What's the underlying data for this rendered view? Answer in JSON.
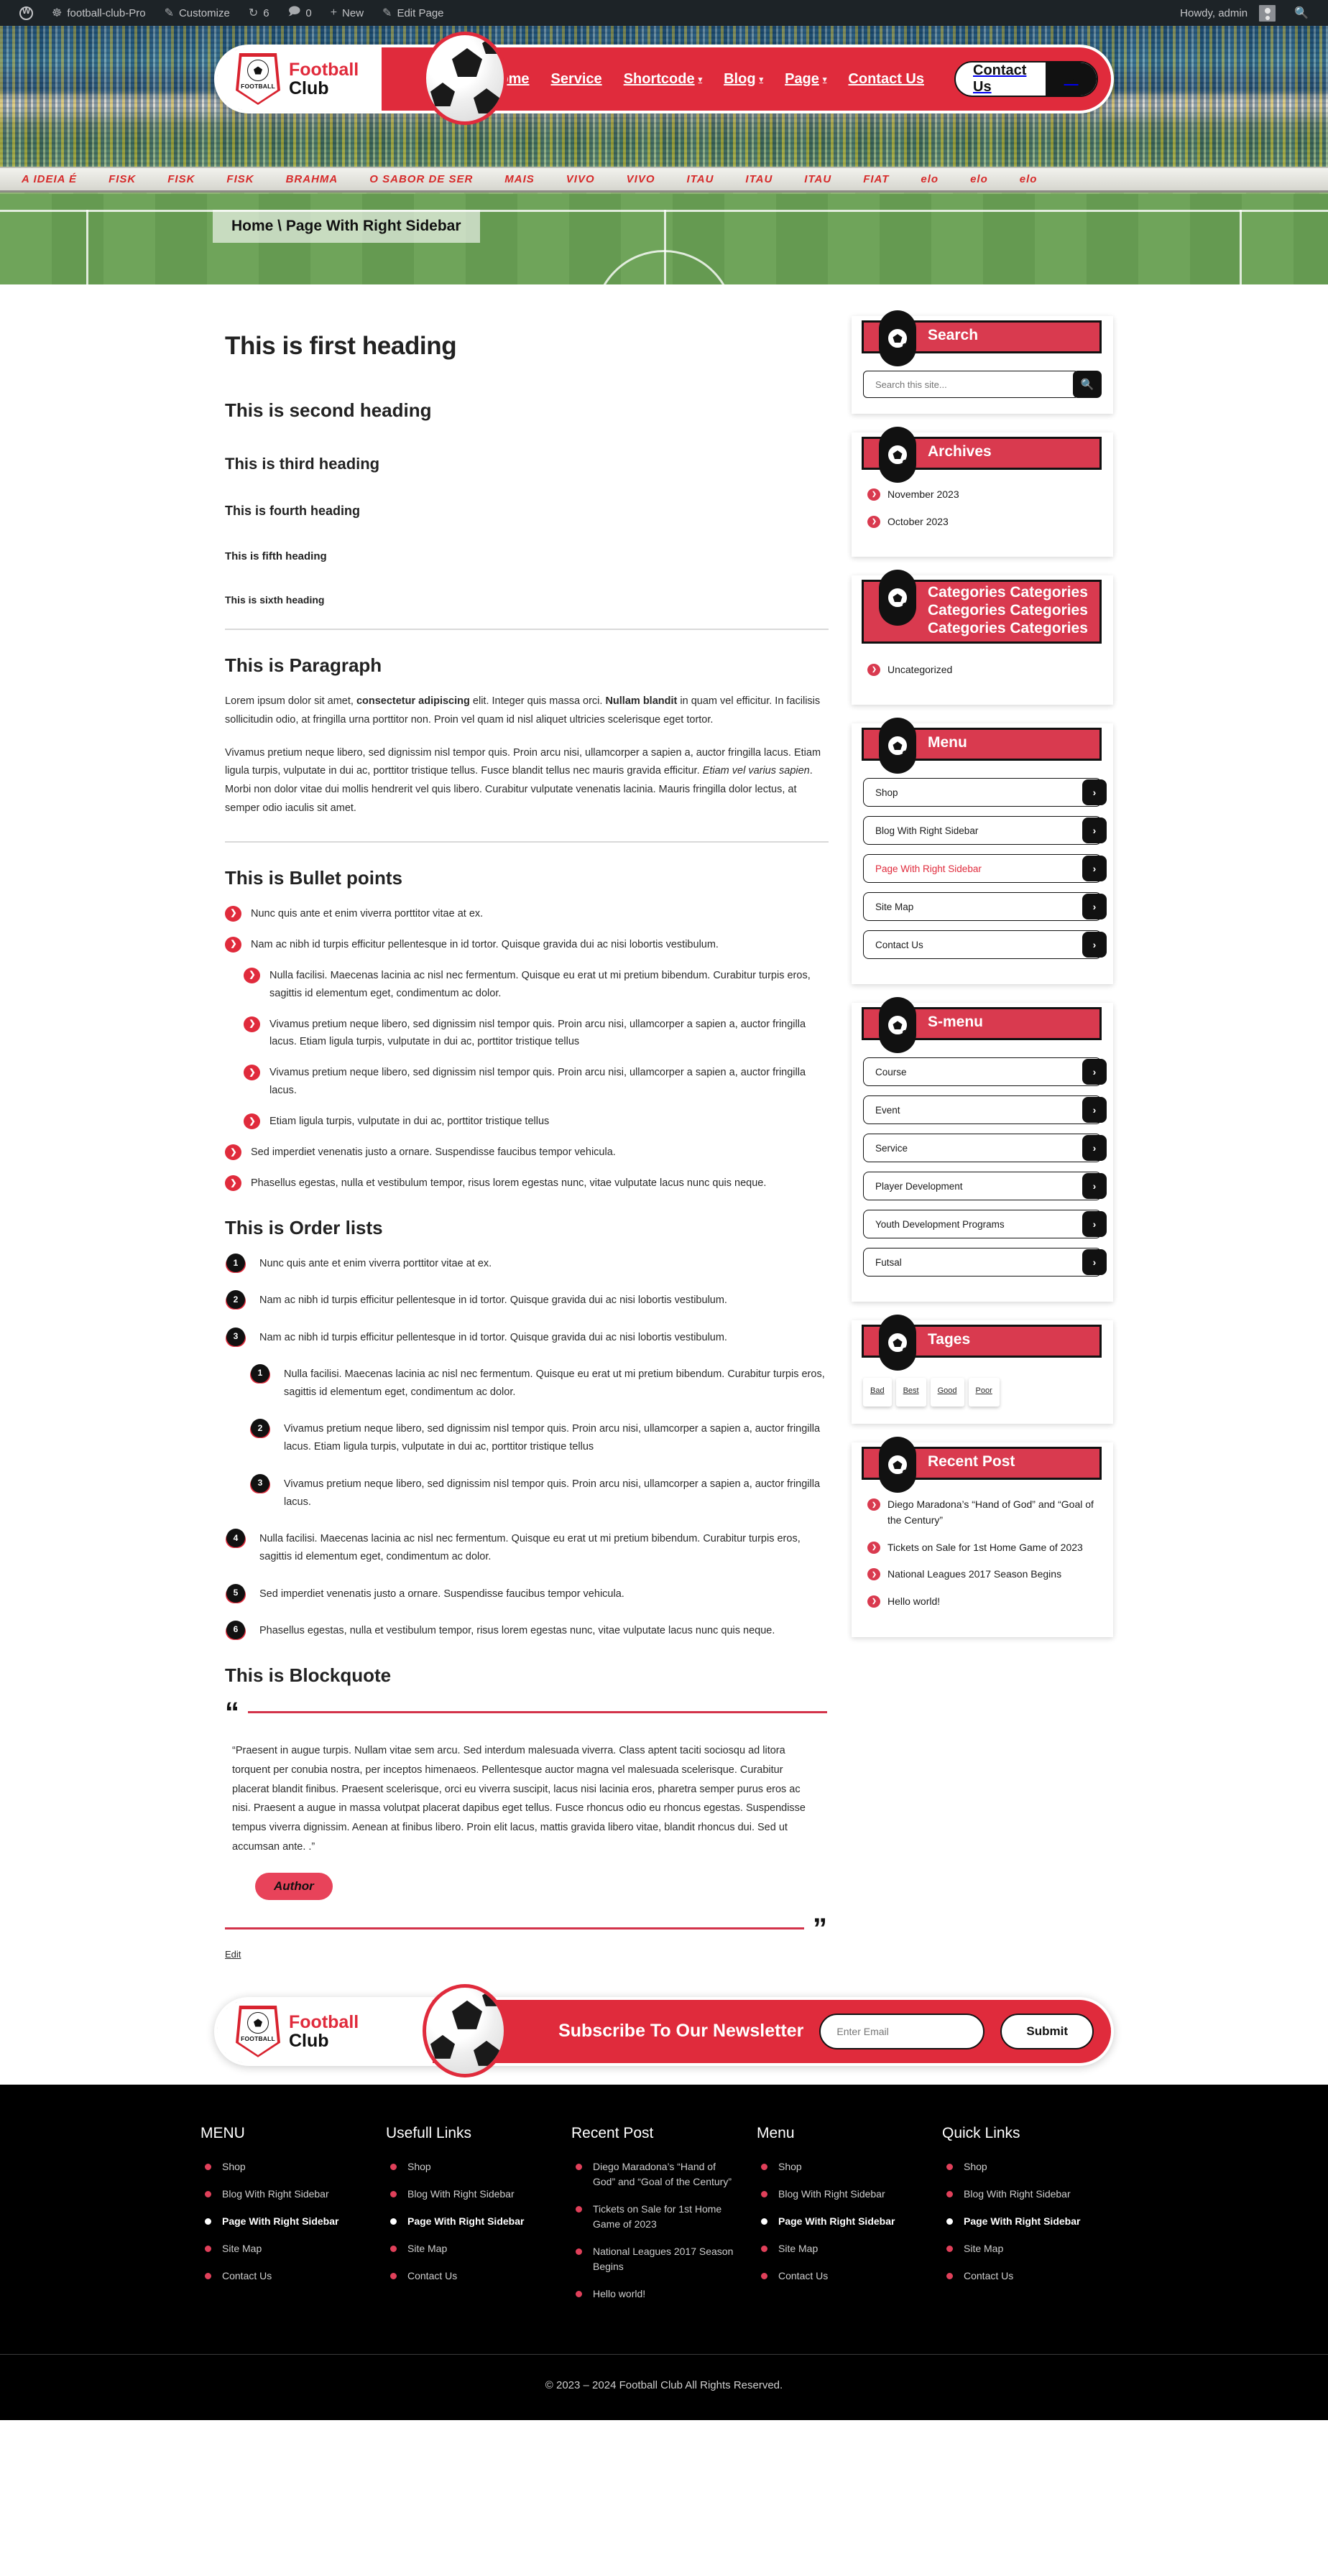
{
  "adminbar": {
    "logo_icon": "wordpress-icon",
    "site_icon": "dashboard-icon",
    "site_name": "football-club-Pro",
    "customize_icon": "pencil-icon",
    "customize": "Customize",
    "updates_icon": "updates-icon",
    "updates_count": "6",
    "comments_icon": "comment-icon",
    "comments_count": "0",
    "new_icon": "plus-icon",
    "new": "New",
    "edit_icon": "edit-icon",
    "edit_page": "Edit Page",
    "howdy": "Howdy, admin",
    "avatar_icon": "avatar-icon",
    "search_icon": "search-icon"
  },
  "header": {
    "logo_top": "Football",
    "logo_bottom": "Club",
    "crest_text": "FOOTBALL",
    "nav": [
      {
        "label": "Home",
        "has_caret": false
      },
      {
        "label": "Service",
        "has_caret": false
      },
      {
        "label": "Shortcode",
        "has_caret": true
      },
      {
        "label": "Blog",
        "has_caret": true
      },
      {
        "label": "Page",
        "has_caret": true
      },
      {
        "label": "Contact Us",
        "has_caret": false
      }
    ],
    "cta_label": "Contact Us",
    "cta_arrow_icon": "arrow-right-icon",
    "breadcrumb": "Home \\ Page With Right Sidebar",
    "hero_ads": [
      "A IDEIA É",
      "FISK",
      "FISK",
      "FISK",
      "BRAHMA",
      "O SABOR DE SER",
      "MAIS",
      "VIVO",
      "VIVO",
      "ITAU",
      "ITAU",
      "ITAU",
      "FIAT",
      "elo",
      "elo",
      "elo"
    ]
  },
  "content": {
    "headings": [
      "This is first heading",
      "This is second heading",
      "This is third heading",
      "This is fourth heading",
      "This is fifth heading",
      "This is sixth heading"
    ],
    "paragraph_title": "This is Paragraph",
    "paragraph_1": {
      "a": "Lorem ipsum dolor sit amet, ",
      "b": "consectetur adipiscing",
      "c": " elit. Integer quis massa orci. ",
      "d": "Nullam blandit",
      "e": " in quam vel efficitur. In facilisis sollicitudin odio, at fringilla urna porttitor non. Proin vel quam id nisl aliquet ultricies scelerisque eget tortor."
    },
    "paragraph_2": {
      "a": "Vivamus pretium neque libero, sed dignissim nisl tempor quis. Proin arcu nisi, ullamcorper a sapien a, auctor fringilla lacus. Etiam ligula turpis, vulputate in dui ac, porttitor tristique tellus. Fusce blandit tellus nec mauris gravida efficitur. ",
      "b": "Etiam vel varius sapien",
      "c": ". Morbi non dolor vitae dui mollis hendrerit vel quis libero. Curabitur vulputate venenatis lacinia. Mauris fringilla dolor lectus, at semper odio iaculis sit amet."
    },
    "bullet_title": "This is Bullet points",
    "bullets": [
      "Nunc quis ante et enim viverra porttitor vitae at ex.",
      "Nam ac nibh id turpis efficitur pellentesque in id tortor. Quisque gravida dui ac nisi lobortis vestibulum."
    ],
    "bullets_nested": [
      "Nulla facilisi. Maecenas lacinia ac nisl nec fermentum. Quisque eu erat ut mi pretium bibendum. Curabitur turpis eros, sagittis id elementum eget, condimentum ac dolor.",
      "Vivamus pretium neque libero, sed dignissim nisl tempor quis. Proin arcu nisi, ullamcorper a sapien a, auctor fringilla lacus. Etiam ligula turpis, vulputate in dui ac, porttitor tristique tellus",
      "Vivamus pretium neque libero, sed dignissim nisl tempor quis. Proin arcu nisi, ullamcorper a sapien a, auctor fringilla lacus.",
      "Etiam ligula turpis, vulputate in dui ac, porttitor tristique tellus"
    ],
    "bullets_tail": [
      "Sed imperdiet venenatis justo a ornare. Suspendisse faucibus tempor vehicula.",
      "Phasellus egestas, nulla et vestibulum tempor, risus lorem egestas nunc, vitae vulputate lacus nunc quis neque."
    ],
    "order_title": "This is Order lists",
    "orders": [
      "Nunc quis ante et enim viverra porttitor vitae at ex.",
      "Nam ac nibh id turpis efficitur pellentesque in id tortor. Quisque gravida dui ac nisi lobortis vestibulum.",
      "Nam ac nibh id turpis efficitur pellentesque in id tortor. Quisque gravida dui ac nisi lobortis vestibulum."
    ],
    "orders_nested": [
      "Nulla facilisi. Maecenas lacinia ac nisl nec fermentum. Quisque eu erat ut mi pretium bibendum. Curabitur turpis eros, sagittis id elementum eget, condimentum ac dolor.",
      "Vivamus pretium neque libero, sed dignissim nisl tempor quis. Proin arcu nisi, ullamcorper a sapien a, auctor fringilla lacus. Etiam ligula turpis, vulputate in dui ac, porttitor tristique tellus",
      "Vivamus pretium neque libero, sed dignissim nisl tempor quis. Proin arcu nisi, ullamcorper a sapien a, auctor fringilla lacus."
    ],
    "orders_tail": [
      "Nulla facilisi. Maecenas lacinia ac nisl nec fermentum. Quisque eu erat ut mi pretium bibendum. Curabitur turpis eros, sagittis id elementum eget, condimentum ac dolor.",
      "Sed imperdiet venenatis justo a ornare. Suspendisse faucibus tempor vehicula.",
      "Phasellus egestas, nulla et vestibulum tempor, risus lorem egestas nunc, vitae vulputate lacus nunc quis neque."
    ],
    "blockquote_title": "This is Blockquote",
    "blockquote_open_icon": "quote-open-icon",
    "blockquote_close_icon": "quote-close-icon",
    "blockquote_text": "“Praesent in augue turpis. Nullam vitae sem arcu. Sed interdum malesuada viverra. Class aptent taciti sociosqu ad litora torquent per conubia nostra, per inceptos himenaeos. Pellentesque auctor magna vel malesuada scelerisque. Curabitur placerat blandit finibus. Praesent scelerisque, orci eu viverra suscipit, lacus nisi lacinia eros, pharetra semper purus eros ac nisi. Praesent a augue in massa volutpat placerat dapibus eget tellus. Fusce rhoncus odio eu rhoncus egestas. Suspendisse tempus viverra dignissim. Aenean at finibus libero. Proin elit lacus, mattis gravida libero vitae, blandit rhoncus dui. Sed ut accumsan ante. .”",
    "blockquote_author": "Author",
    "edit_link": "Edit"
  },
  "sidebar": {
    "search": {
      "title": "Search",
      "icon": "soccer-ball-icon",
      "placeholder": "Search this site...",
      "button_icon": "search-icon"
    },
    "archives": {
      "title": "Archives",
      "icon": "soccer-ball-icon",
      "items": [
        "November 2023",
        "October 2023"
      ]
    },
    "categories": {
      "title": "Categories Categories Categories Categories Categories Categories",
      "icon": "soccer-ball-icon",
      "items": [
        "Uncategorized"
      ]
    },
    "menu": {
      "title": "Menu",
      "icon": "soccer-ball-icon",
      "items": [
        {
          "label": "Shop",
          "active": false
        },
        {
          "label": "Blog With Right Sidebar",
          "active": false
        },
        {
          "label": "Page With Right Sidebar",
          "active": true
        },
        {
          "label": "Site Map",
          "active": false
        },
        {
          "label": "Contact Us",
          "active": false
        }
      ]
    },
    "smenu": {
      "title": "S-menu",
      "icon": "soccer-ball-icon",
      "items": [
        {
          "label": "Course",
          "active": false
        },
        {
          "label": "Event",
          "active": false
        },
        {
          "label": "Service",
          "active": false
        },
        {
          "label": "Player Development",
          "active": false
        },
        {
          "label": "Youth Development Programs",
          "active": false
        },
        {
          "label": "Futsal",
          "active": false
        }
      ]
    },
    "tages": {
      "title": "Tages",
      "icon": "soccer-ball-icon",
      "tags": [
        "Bad",
        "Best",
        "Good",
        "Poor"
      ]
    },
    "recent": {
      "title": "Recent Post",
      "icon": "soccer-ball-icon",
      "items": [
        "Diego Maradona’s “Hand of God” and “Goal of the Century”",
        "Tickets on Sale for 1st Home Game of 2023",
        "National Leagues 2017 Season Begins",
        "Hello world!"
      ]
    }
  },
  "newsletter": {
    "logo_top": "Football",
    "logo_bottom": "Club",
    "crest_text": "FOOTBALL",
    "title": "Subscribe To Our Newsletter",
    "input_placeholder": "Enter Email",
    "submit_label": "Submit"
  },
  "footer": {
    "columns": [
      {
        "heading": "MENU",
        "items": [
          {
            "label": "Shop",
            "active": false
          },
          {
            "label": "Blog With Right Sidebar",
            "active": false
          },
          {
            "label": "Page With Right Sidebar",
            "active": true
          },
          {
            "label": "Site Map",
            "active": false
          },
          {
            "label": "Contact Us",
            "active": false
          }
        ]
      },
      {
        "heading": "Usefull Links",
        "items": [
          {
            "label": "Shop",
            "active": false
          },
          {
            "label": "Blog With Right Sidebar",
            "active": false
          },
          {
            "label": "Page With Right Sidebar",
            "active": true
          },
          {
            "label": "Site Map",
            "active": false
          },
          {
            "label": "Contact Us",
            "active": false
          }
        ]
      },
      {
        "heading": "Recent Post",
        "items": [
          {
            "label": "Diego Maradona’s “Hand of God” and “Goal of the Century”",
            "active": false
          },
          {
            "label": "Tickets on Sale for 1st Home Game of 2023",
            "active": false
          },
          {
            "label": "National Leagues 2017 Season Begins",
            "active": false
          },
          {
            "label": "Hello world!",
            "active": false
          }
        ]
      },
      {
        "heading": "Menu",
        "items": [
          {
            "label": "Shop",
            "active": false
          },
          {
            "label": "Blog With Right Sidebar",
            "active": false
          },
          {
            "label": "Page With Right Sidebar",
            "active": true
          },
          {
            "label": "Site Map",
            "active": false
          },
          {
            "label": "Contact Us",
            "active": false
          }
        ]
      },
      {
        "heading": "Quick Links",
        "items": [
          {
            "label": "Shop",
            "active": false
          },
          {
            "label": "Blog With Right Sidebar",
            "active": false
          },
          {
            "label": "Page With Right Sidebar",
            "active": true
          },
          {
            "label": "Site Map",
            "active": false
          },
          {
            "label": "Contact Us",
            "active": false
          }
        ]
      }
    ],
    "copyright": "© 2023 – 2024 Football Club All Rights Reserved."
  },
  "colors": {
    "brand_red": "#e02b3c",
    "widget_red": "#d93a4f",
    "black": "#111111",
    "admin_bar": "#1d2327"
  }
}
